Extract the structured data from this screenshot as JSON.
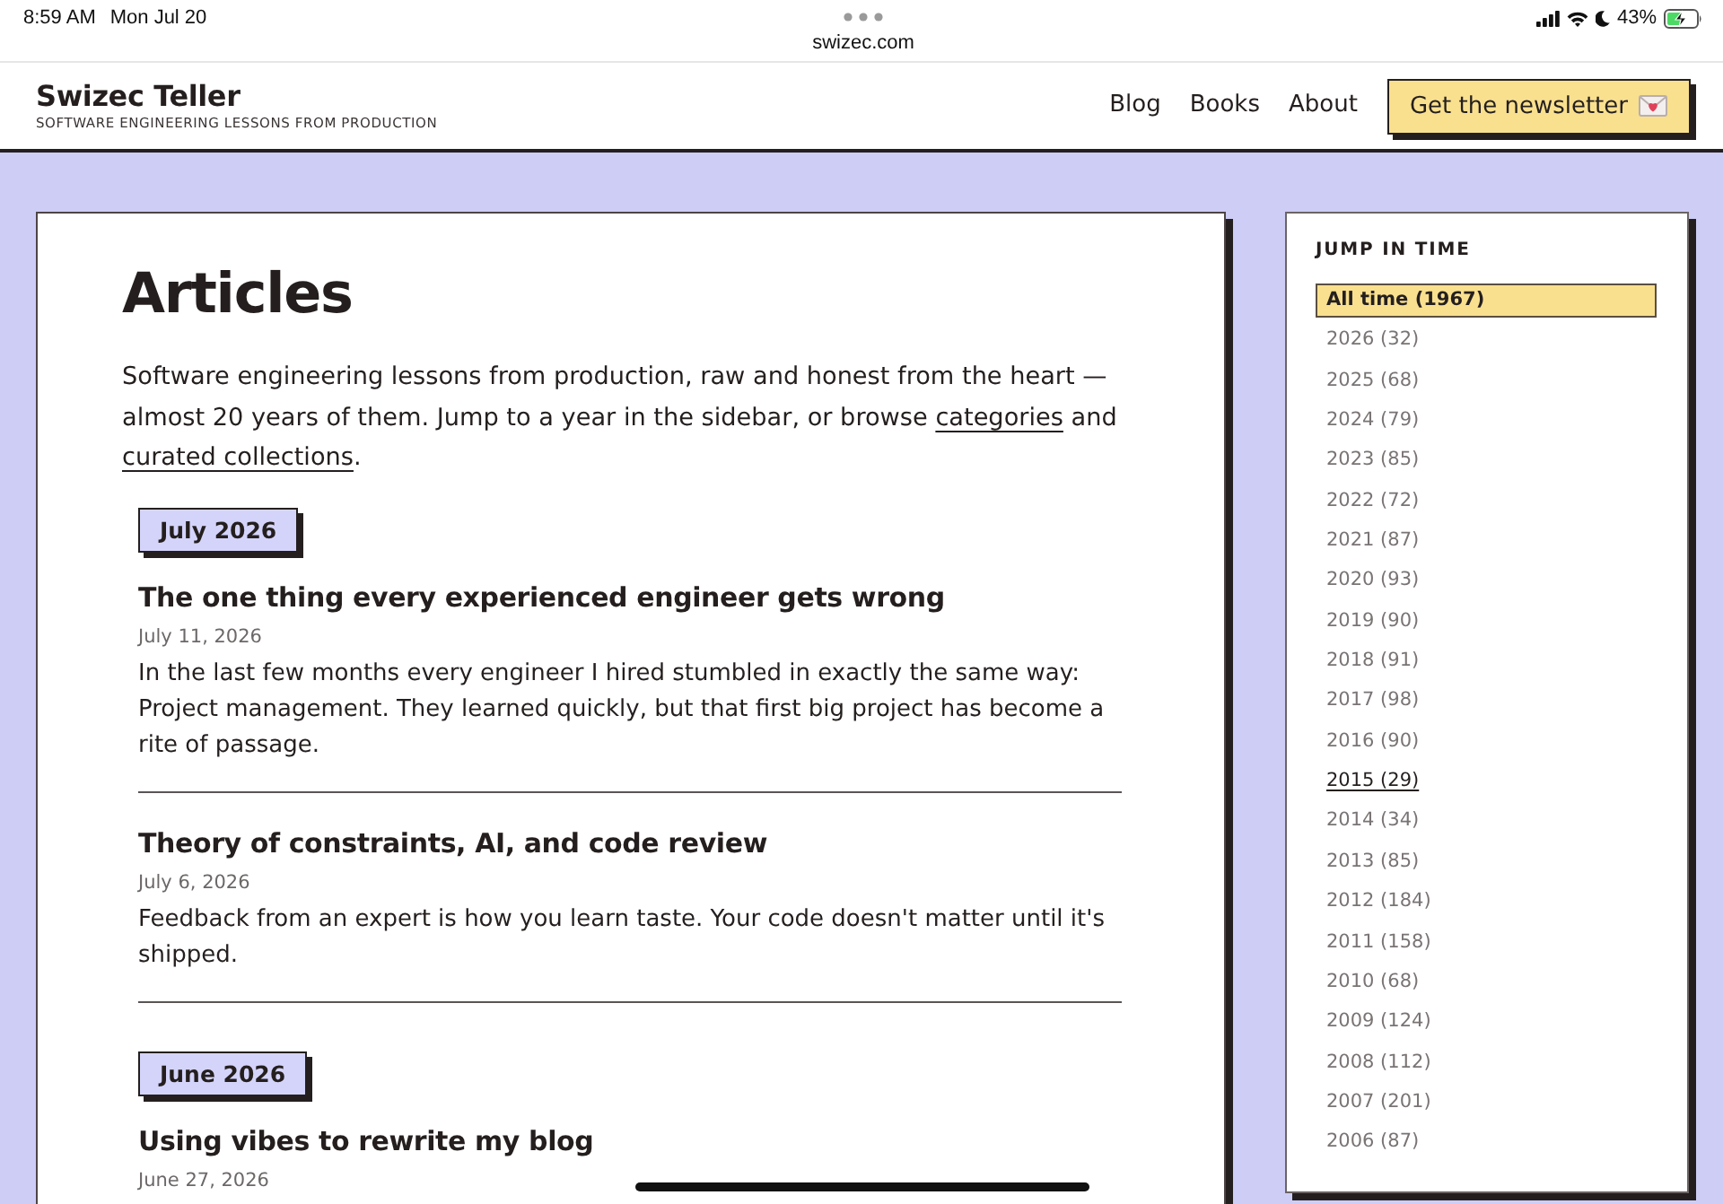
{
  "status_bar": {
    "time": "8:59 AM",
    "date": "Mon Jul 20",
    "url": "swizec.com",
    "battery": "43%"
  },
  "header": {
    "title": "Swizec Teller",
    "tagline": "SOFTWARE ENGINEERING LESSONS FROM PRODUCTION",
    "nav": [
      {
        "label": "Blog"
      },
      {
        "label": "Books"
      },
      {
        "label": "About"
      }
    ],
    "newsletter_button": "Get the newsletter"
  },
  "articles": {
    "heading": "Articles",
    "intro": [
      {
        "kind": "text",
        "text": "Software engineering lessons from production, raw and honest from the heart — almost 20 years of them. Jump to a year in the sidebar, or browse "
      },
      {
        "kind": "link",
        "text": "categories"
      },
      {
        "kind": "text",
        "text": " and "
      },
      {
        "kind": "link",
        "text": "curated collections"
      },
      {
        "kind": "text",
        "text": "."
      }
    ],
    "groups": [
      {
        "month": "July 2026",
        "posts": [
          {
            "title": "The one thing every experienced engineer gets wrong",
            "date": "July 11, 2026",
            "excerpt": "In the last few months every engineer I hired stumbled in exactly the same way: Project management. They learned quickly, but that first big project has become a rite of passage."
          },
          {
            "title": "Theory of constraints, AI, and code review",
            "date": "July 6, 2026",
            "excerpt": "Feedback from an expert is how you learn taste. Your code doesn't matter until it's shipped."
          }
        ]
      },
      {
        "month": "June 2026",
        "posts": [
          {
            "title": "Using vibes to rewrite my blog",
            "date": "June 27, 2026"
          }
        ]
      }
    ]
  },
  "sidebar": {
    "heading": "JUMP IN TIME",
    "items": [
      {
        "label": "All time (1967)",
        "selected": true,
        "hovered": false
      },
      {
        "label": "2026 (32)",
        "selected": false,
        "hovered": false
      },
      {
        "label": "2025 (68)",
        "selected": false,
        "hovered": false
      },
      {
        "label": "2024 (79)",
        "selected": false,
        "hovered": false
      },
      {
        "label": "2023 (85)",
        "selected": false,
        "hovered": false
      },
      {
        "label": "2022 (72)",
        "selected": false,
        "hovered": false
      },
      {
        "label": "2021 (87)",
        "selected": false,
        "hovered": false
      },
      {
        "label": "2020 (93)",
        "selected": false,
        "hovered": false
      },
      {
        "label": "2019 (90)",
        "selected": false,
        "hovered": false
      },
      {
        "label": "2018 (91)",
        "selected": false,
        "hovered": false
      },
      {
        "label": "2017 (98)",
        "selected": false,
        "hovered": false
      },
      {
        "label": "2016 (90)",
        "selected": false,
        "hovered": false
      },
      {
        "label": "2015 (29)",
        "selected": false,
        "hovered": true
      },
      {
        "label": "2014 (34)",
        "selected": false,
        "hovered": false
      },
      {
        "label": "2013 (85)",
        "selected": false,
        "hovered": false
      },
      {
        "label": "2012 (184)",
        "selected": false,
        "hovered": false
      },
      {
        "label": "2011 (158)",
        "selected": false,
        "hovered": false
      },
      {
        "label": "2010 (68)",
        "selected": false,
        "hovered": false
      },
      {
        "label": "2009 (124)",
        "selected": false,
        "hovered": false
      },
      {
        "label": "2008 (112)",
        "selected": false,
        "hovered": false
      },
      {
        "label": "2007 (201)",
        "selected": false,
        "hovered": false
      },
      {
        "label": "2006 (87)",
        "selected": false,
        "hovered": false
      }
    ]
  }
}
